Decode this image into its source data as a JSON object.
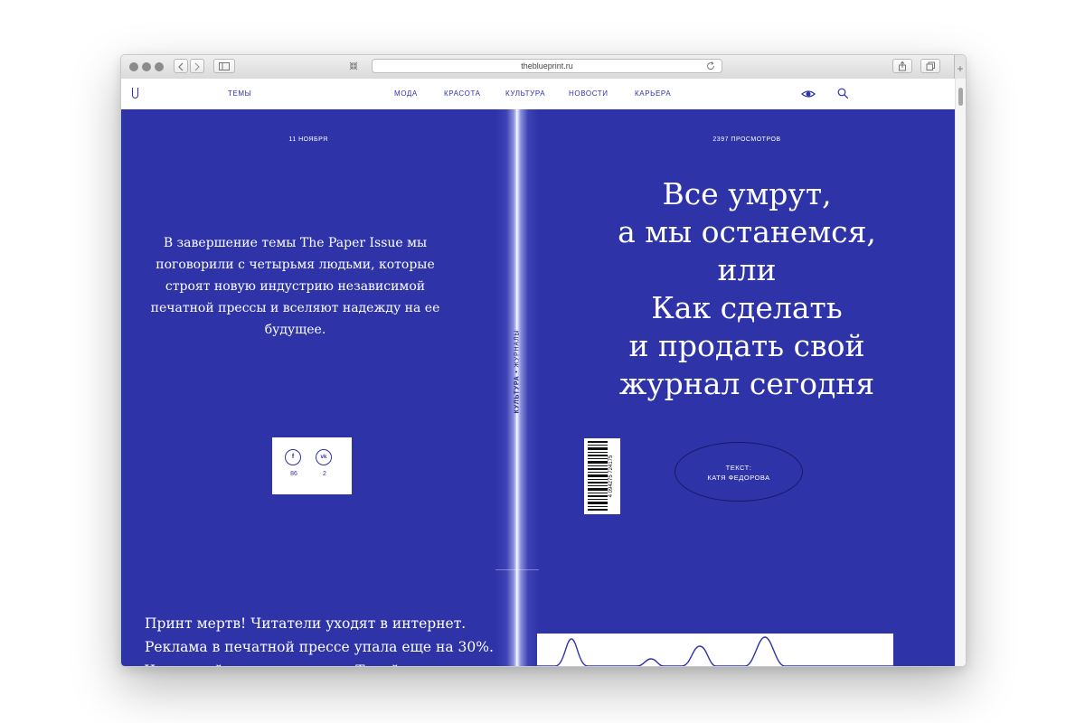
{
  "browser": {
    "url": "theblueprint.ru"
  },
  "nav": {
    "topics": "ТЕМЫ",
    "items": [
      "МОДА",
      "КРАСОТА",
      "КУЛЬТУРА",
      "НОВОСТИ",
      "КАРЬЕРА"
    ]
  },
  "left_page": {
    "date": "11 НОЯБРЯ",
    "lead": "В завершение темы The Paper Issue мы поговорили с четырьмя людьми, которые строят новую индустрию независимой печатной прессы и вселяют надежду на ее будущее.",
    "share": {
      "facebook_count": "86",
      "vk_count": "2",
      "facebook_icon": "f",
      "vk_icon": "vk"
    },
    "bottom_text": "Принт мертв! Читатели уходят в интернет. Реклама в печатной прессе упала еще на 30%. Что ж, сейчас самое время. Такой"
  },
  "spine": {
    "category": "КУЛЬТУРА",
    "subcategory": "ЖУРНАЛЫ"
  },
  "right_page": {
    "views": "2397 ПРОСМОТРОВ",
    "headline_lines": [
      "Все умрут,",
      "а мы останемся,",
      "или",
      "Как сделать",
      "и продать свой",
      "журнал сегодня"
    ],
    "barcode_number": "4 094275 724175",
    "credit_label": "ТЕКСТ:",
    "credit_author": "КАТЯ ФЕДОРОВА"
  },
  "colors": {
    "brand_blue": "#2e33a8",
    "white": "#ffffff"
  }
}
